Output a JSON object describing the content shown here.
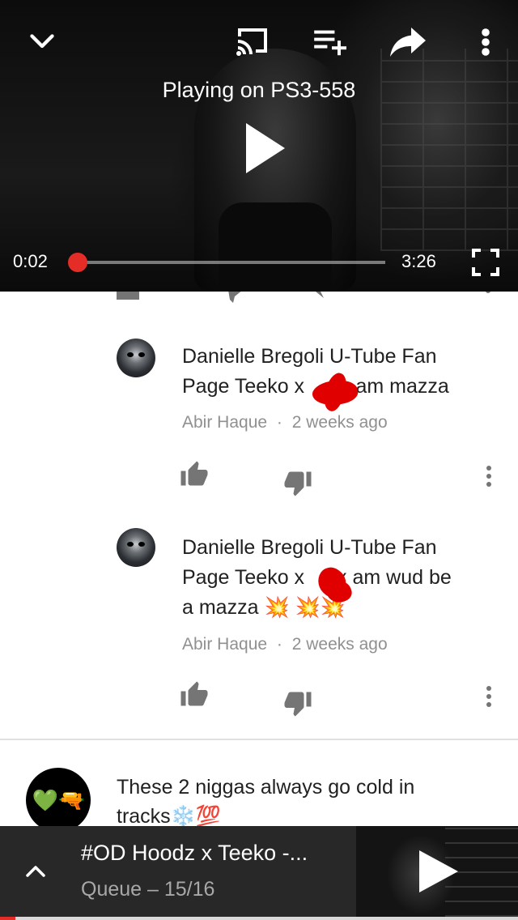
{
  "player": {
    "playing_on": "Playing on PS3-558",
    "time_current": "0:02",
    "time_total": "3:26",
    "progress_fraction": 0.01,
    "icons": [
      "chevron-down-icon",
      "cast-icon",
      "add-to-queue-icon",
      "share-icon",
      "more-vert-icon",
      "play-icon",
      "fullscreen-icon"
    ]
  },
  "comments": {
    "replies": [
      {
        "text_line1": "Danielle Bregoli U-Tube Fan",
        "text_line2_a": "Page Teeko x",
        "text_line2_b": "x am mazza",
        "author": "Abir Haque",
        "separator": "·",
        "time": "2 weeks ago"
      },
      {
        "text_line1": "Danielle Bregoli U-Tube Fan",
        "text_line2_a": "Page Teeko x",
        "text_line2_b": "x am wud be",
        "text_line3": "a mazza",
        "emojis": "💥 💥💥",
        "author": "Abir Haque",
        "separator": "·",
        "time": "2 weeks ago"
      }
    ],
    "top_comment": {
      "avatar_emojis": "💚🔫",
      "text_line1": "These 2 niggas always go cold in",
      "text_line2": "tracks",
      "text_emojis": "❄️💯"
    }
  },
  "queue": {
    "title": "#OD Hoodz x Teeko -...",
    "subtitle": "Queue – 15/16",
    "progress_fraction": 0.03
  },
  "colors": {
    "accent": "#e52d27",
    "text_primary": "#212121",
    "text_secondary": "#909090",
    "icon_gray": "#757575",
    "queue_bg": "#282828"
  }
}
